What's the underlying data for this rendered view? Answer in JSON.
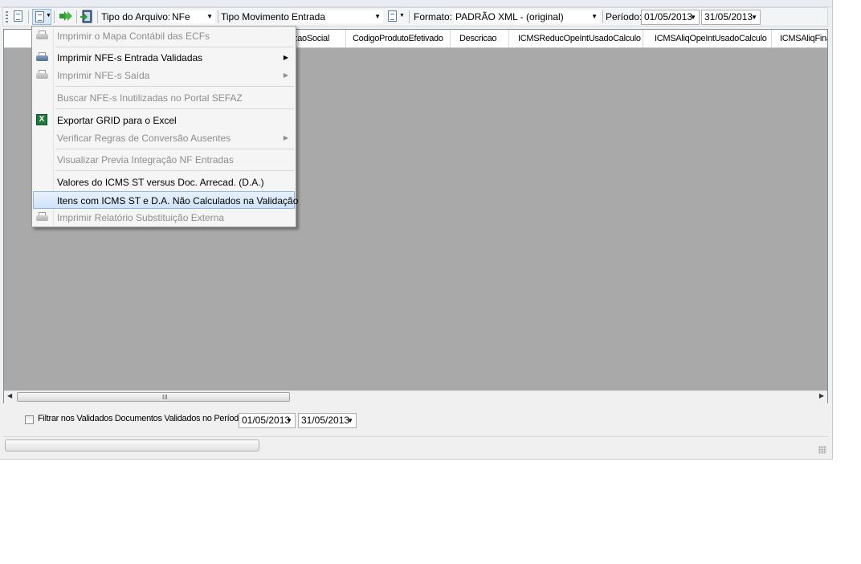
{
  "toolbar": {
    "tipo_arquivo_label": "Tipo do Arquivo:",
    "tipo_arquivo_value": "NFe",
    "tipo_movimento_label": "Tipo Movimento",
    "tipo_movimento_value": "Entrada",
    "formato_label": "Formato:",
    "formato_value": "PADRÃO XML - (original)",
    "periodo_label": "Período:",
    "periodo_inicio": "01/05/2013",
    "periodo_fim": "31/05/2013"
  },
  "grid": {
    "columns": [
      "zaoSocial",
      "CodigoProdutoEfetivado",
      "Descricao",
      "ICMSReducOpeIntUsadoCalculo",
      "ICMSAliqOpeIntUsadoCalculo",
      "ICMSAliqFinal"
    ]
  },
  "menu": {
    "items": [
      {
        "label": "Imprimir o Mapa Contábil das ECFs",
        "disabled": true,
        "icon": "printer-icon"
      },
      {
        "label": "Imprimir NFE-s Entrada Validadas",
        "disabled": false,
        "icon": "printer-icon",
        "submenu": true
      },
      {
        "label": "Imprimir NFE-s Saída",
        "disabled": true,
        "icon": "printer-icon",
        "submenu": true
      },
      {
        "label": "Buscar NFE-s Inutilizadas no Portal SEFAZ",
        "disabled": true
      },
      {
        "label": "Exportar GRID para o Excel",
        "disabled": false,
        "icon": "excel-icon"
      },
      {
        "label": "Verificar Regras de Conversão Ausentes",
        "disabled": true,
        "submenu": true
      },
      {
        "label": "Visualizar Previa Integração NF Entradas",
        "disabled": true
      },
      {
        "label": "Valores do ICMS ST versus Doc. Arrecad. (D.A.)",
        "disabled": false
      },
      {
        "label": "Itens com ICMS ST e D.A. Não Calculados na Validação",
        "disabled": false,
        "highlighted": true
      },
      {
        "label": "Imprimir Relatório Substituição Externa",
        "disabled": true,
        "icon": "printer-icon"
      }
    ]
  },
  "filter": {
    "label": "Filtrar nos Validados Documentos Validados no Período:",
    "checked": false,
    "data_inicio": "01/05/2013",
    "data_fim": "31/05/2013"
  },
  "scroll_glyph": "III"
}
